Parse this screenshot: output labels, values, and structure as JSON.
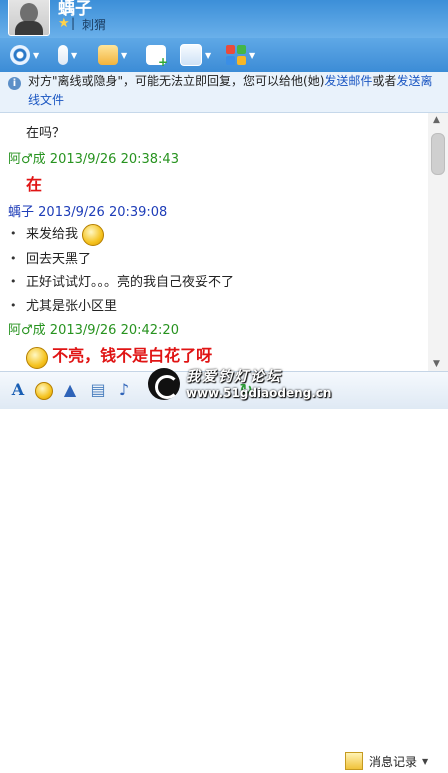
{
  "window": {
    "contact_name": "蝺子",
    "signature": "刺猬",
    "signature_sep": "|"
  },
  "notice": {
    "text_before": "对方\"离线或隐身\"，可能无法立即回复，您可以给他(她)",
    "link_email": "发送邮件",
    "text_or": "或者",
    "link_file": "发送离线文件"
  },
  "chat": {
    "lines": [
      {
        "type": "text",
        "text": "在吗？"
      },
      {
        "type": "header",
        "sender": "阿♂成",
        "time": "2013/9/26 20:38:43"
      },
      {
        "type": "big",
        "text": "在"
      },
      {
        "type": "header",
        "sender": "蝺子",
        "time": "2013/9/26 20:39:08"
      },
      {
        "type": "bullet",
        "text": "来发给我"
      },
      {
        "type": "bullet",
        "text": "回去天黑了"
      },
      {
        "type": "bullet",
        "text": "正好试试灯。。。亮的我自己夜妥不了"
      },
      {
        "type": "bullet",
        "text": "尤其是张小区里"
      },
      {
        "type": "header",
        "sender": "阿♂成",
        "time": "2013/9/26 20:42:20"
      },
      {
        "type": "big",
        "text": "不亮，钱不是白花了呀"
      }
    ]
  },
  "bottom": {
    "history_label": "消息记录",
    "font_label": "A"
  },
  "watermark": {
    "cn": "我爱钓灯论坛",
    "url": "www.51gdiaodeng.cn"
  },
  "colors": {
    "titlebar": "#3c8fd8",
    "link": "#1a56c2",
    "green_header": "#27931f",
    "blue_header": "#1e3db8",
    "red_bold": "#e01414"
  }
}
